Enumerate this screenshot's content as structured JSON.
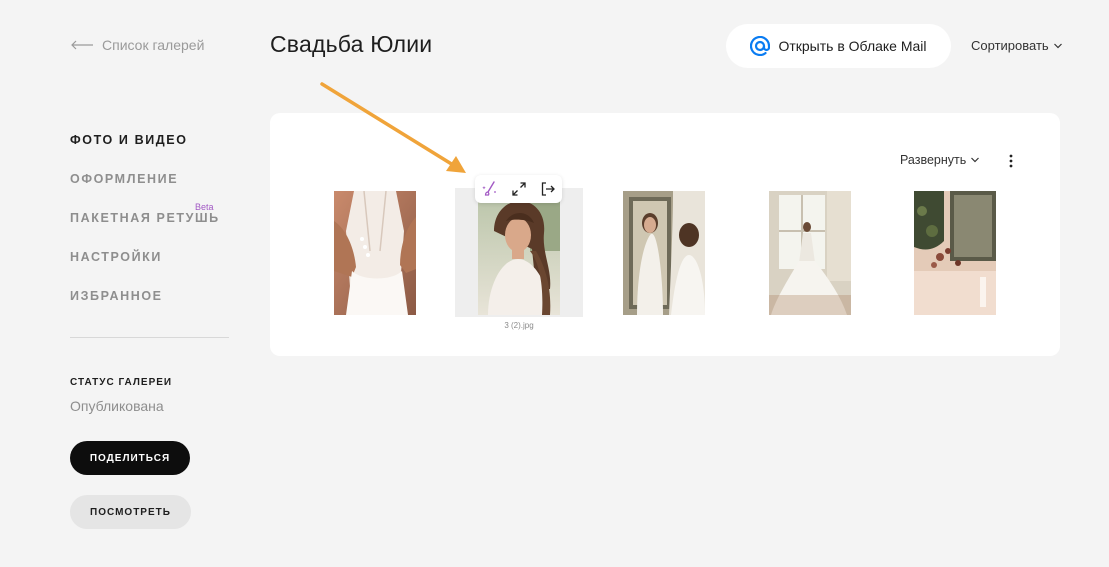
{
  "header": {
    "back_label": "Список галерей",
    "title": "Свадьба Юлии",
    "open_button_label": "Открыть в Облаке Mail",
    "sort_label": "Сортировать"
  },
  "sidebar": {
    "items": [
      {
        "label": "ФОТО И ВИДЕО"
      },
      {
        "label": "ОФОРМЛЕНИЕ"
      },
      {
        "label": "ПАКЕТНАЯ РЕТУШЬ",
        "badge": "Beta"
      },
      {
        "label": "НАСТРОЙКИ"
      },
      {
        "label": "ИЗБРАННОЕ"
      }
    ],
    "status_label": "СТАТУС ГАЛЕРЕИ",
    "status_value": "Опубликована",
    "share_button": "ПОДЕЛИТЬСЯ",
    "view_button": "ПОСМОТРЕТЬ"
  },
  "gallery": {
    "expand_label": "Развернуть",
    "hovered_caption": "3 (2).jpg",
    "photos": [
      {
        "icon": "bride-dress-lacing-photo"
      },
      {
        "icon": "bride-portrait-photo"
      },
      {
        "icon": "bride-mirror-photo"
      },
      {
        "icon": "bride-window-photo"
      },
      {
        "icon": "flowers-decor-photo"
      }
    ]
  },
  "colors": {
    "accent_arrow": "#f0a43a",
    "mail_icon": "#0a7cf2",
    "retouch_icon": "#a259c4",
    "beta": "#a259c4"
  }
}
